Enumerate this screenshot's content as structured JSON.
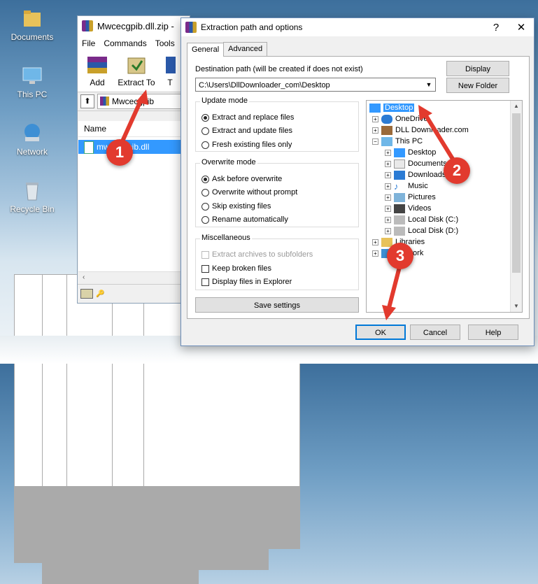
{
  "desktop": {
    "icons": [
      {
        "label": "Documents",
        "icon": "documents-folder-icon"
      },
      {
        "label": "This PC",
        "icon": "this-pc-icon"
      },
      {
        "label": "Network",
        "icon": "network-icon"
      },
      {
        "label": "Recycle Bin",
        "icon": "recycle-bin-icon"
      }
    ]
  },
  "winrar": {
    "title": "Mwcecgpib.dll.zip -",
    "menu": [
      "File",
      "Commands",
      "Tools"
    ],
    "toolbar": {
      "add": "Add",
      "extract_to": "Extract To",
      "third": "T"
    },
    "address": "Mwcecgpib",
    "column_name": "Name",
    "file": "mwcecgpib.dll"
  },
  "dialog": {
    "title": "Extraction path and options",
    "help": "?",
    "close": "✕",
    "tabs": [
      "General",
      "Advanced"
    ],
    "dest_label": "Destination path (will be created if does not exist)",
    "dest_value": "C:\\Users\\DllDownloader_com\\Desktop",
    "display_btn": "Display",
    "new_folder_btn": "New Folder",
    "update_mode": {
      "title": "Update mode",
      "options": [
        "Extract and replace files",
        "Extract and update files",
        "Fresh existing files only"
      ]
    },
    "overwrite_mode": {
      "title": "Overwrite mode",
      "options": [
        "Ask before overwrite",
        "Overwrite without prompt",
        "Skip existing files",
        "Rename automatically"
      ]
    },
    "misc": {
      "title": "Miscellaneous",
      "options": [
        "Extract archives to subfolders",
        "Keep broken files",
        "Display files in Explorer"
      ]
    },
    "save_settings": "Save settings",
    "tree": [
      {
        "label": "Desktop"
      },
      {
        "label": "OneDrive"
      },
      {
        "label": "DLL Downloader.com"
      },
      {
        "label": "This PC"
      },
      {
        "label": "Desktop"
      },
      {
        "label": "Documents"
      },
      {
        "label": "Downloads"
      },
      {
        "label": "Music"
      },
      {
        "label": "Pictures"
      },
      {
        "label": "Videos"
      },
      {
        "label": "Local Disk (C:)"
      },
      {
        "label": "Local Disk (D:)"
      },
      {
        "label": "Libraries"
      },
      {
        "label": "Network"
      }
    ],
    "ok": "OK",
    "cancel": "Cancel",
    "help_btn": "Help"
  },
  "callouts": [
    "1",
    "2",
    "3"
  ],
  "colors": {
    "accent": "#3399ff",
    "callout": "#e23a2e"
  }
}
